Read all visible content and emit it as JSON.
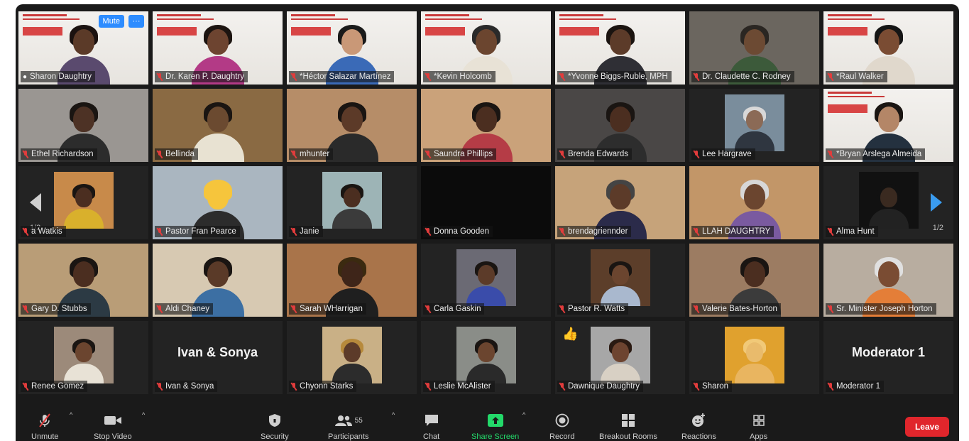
{
  "tiles": [
    {
      "name": "Sharon Daughtry",
      "speaker": true,
      "mic_off": false,
      "bg": "slide",
      "skin": "#5b3a28",
      "hair": "#1b1210",
      "shirt": "#5a4a6e"
    },
    {
      "name": "Dr. Karen P. Daughtry",
      "mic_off": true,
      "bg": "slide",
      "skin": "#6d4430",
      "hair": "#1c1410",
      "shirt": "#b33a86"
    },
    {
      "name": "*Héctor Salazar Martínez",
      "mic_off": true,
      "bg": "slide",
      "skin": "#c99877",
      "hair": "#1a1a1a",
      "shirt": "#3a6ab7"
    },
    {
      "name": "*Kevin Holcomb",
      "mic_off": true,
      "bg": "slide",
      "skin": "#6b452f",
      "hair": "#2a2a2a",
      "shirt": "#e8e2d6"
    },
    {
      "name": "*Yvonne Biggs-Ruble, MPH",
      "mic_off": true,
      "bg": "slide",
      "skin": "#5c3b29",
      "hair": "#1b1410",
      "shirt": "#2f2f35"
    },
    {
      "name": "Dr. Claudette C. Rodney",
      "mic_off": true,
      "bg": "#6b665f",
      "skin": "#6c4a33",
      "hair": "#2a2622",
      "shirt": "#3c5a3a"
    },
    {
      "name": "*Raul Walker",
      "mic_off": true,
      "bg": "slide",
      "skin": "#7a4c33",
      "hair": "#151515",
      "shirt": "#e0d8cc"
    },
    {
      "name": "Ethel Richardson",
      "mic_off": true,
      "bg": "#9a9692",
      "skin": "#4d3225",
      "hair": "#1a1512",
      "shirt": "#2c2c2c"
    },
    {
      "name": "Bellinda",
      "mic_off": true,
      "bg": "#8a6a43",
      "skin": "#6b4a30",
      "hair": "#1a1512",
      "shirt": "#e8e2d2"
    },
    {
      "name": "mhunter",
      "mic_off": true,
      "bg": "#b68d68",
      "skin": "#5c3a28",
      "hair": "#1a1512",
      "shirt": "#2a2a2a"
    },
    {
      "name": "Saundra Phillips",
      "mic_off": true,
      "bg": "#caa27a",
      "skin": "#4b2e20",
      "hair": "#1a1512",
      "shirt": "#b53c46"
    },
    {
      "name": "Brenda Edwards",
      "mic_off": true,
      "bg": "#4a4746",
      "skin": "#4b2e20",
      "hair": "#1a1512",
      "shirt": "#2d2d2d"
    },
    {
      "name": "Lee Hargrave",
      "mic_off": true,
      "bg": "#232323",
      "thumb": "#7a8d9c",
      "skin": "#8b6a56",
      "hair": "#d8d8d8",
      "shirt": "#2f3640"
    },
    {
      "name": "*Bryan Arslega Almeida",
      "mic_off": true,
      "bg": "slide",
      "skin": "#b48667",
      "hair": "#1a1512",
      "shirt": "#24313f"
    },
    {
      "name": "a Watkis",
      "mic_off": true,
      "bg": "#232323",
      "thumb": "#c88a4a",
      "skin": "#4b2e20",
      "hair": "#1a1512",
      "shirt": "#d9b02c",
      "nav": "left",
      "page": "1/2"
    },
    {
      "name": "Pastor Fran Pearce",
      "mic_off": true,
      "bg": "#aab6c0",
      "skin": "#f6c53c",
      "hair": "#f6c53c",
      "shirt": "#2c2c2c"
    },
    {
      "name": "Janie",
      "mic_off": true,
      "bg": "#232323",
      "thumb": "#9db4b6",
      "skin": "#4b2e20",
      "hair": "#1a1512",
      "shirt": "#3b3b3b"
    },
    {
      "name": "Donna Gooden",
      "mic_off": true,
      "bg": "#0b0b0b",
      "empty": true
    },
    {
      "name": "brendagriennder",
      "mic_off": true,
      "bg": "#c6a37a",
      "skin": "#5c3b29",
      "hair": "#444444",
      "shirt": "#2b2b4a"
    },
    {
      "name": "LLAH DAUGHTRY",
      "mic_off": true,
      "bg": "#c29668",
      "skin": "#6b452f",
      "hair": "#d7d7d7",
      "shirt": "#7a5aa0"
    },
    {
      "name": "Alma Hunt",
      "mic_off": true,
      "bg": "#232323",
      "thumb": "#111111",
      "skin": "#3a2a20",
      "hair": "#111111",
      "shirt": "#222222",
      "nav": "right",
      "page": "1/2"
    },
    {
      "name": "Gary D. Stubbs",
      "mic_off": true,
      "bg": "#b99d77",
      "skin": "#4b2e20",
      "hair": "#1a1512",
      "shirt": "#2c3a44"
    },
    {
      "name": "Aldi Chaney",
      "mic_off": true,
      "bg": "#d7c9b2",
      "skin": "#5a3a28",
      "hair": "#1a1512",
      "shirt": "#3c6fa3"
    },
    {
      "name": "Sarah WHarrigan",
      "mic_off": true,
      "bg": "#a9744a",
      "skin": "#3e2519",
      "hair": "#3b2a10",
      "shirt": "#1f1f1f"
    },
    {
      "name": "Carla Gaskin",
      "mic_off": true,
      "bg": "#232323",
      "thumb": "#6b6a74",
      "skin": "#5c3b29",
      "hair": "#1a1512",
      "shirt": "#3a4caa"
    },
    {
      "name": "Pastor R. Watts",
      "mic_off": true,
      "bg": "#232323",
      "thumb": "#5c3e2a",
      "skin": "#6b452f",
      "hair": "#1a1512",
      "shirt": "#a9b8ce"
    },
    {
      "name": "Valerie Bates-Horton",
      "mic_off": true,
      "bg": "#9c7c62",
      "skin": "#4b2e20",
      "hair": "#1a1512",
      "shirt": "#3b3b3b"
    },
    {
      "name": "Sr. Minister Joseph Horton",
      "mic_off": true,
      "bg": "#b8ada0",
      "skin": "#7a4c33",
      "hair": "#e0e0e0",
      "shirt": "#e47e38"
    },
    {
      "name": "Renee Gomez",
      "mic_off": true,
      "bg": "#232323",
      "thumb": "#9c8a7a",
      "skin": "#6b452f",
      "hair": "#1a1512",
      "shirt": "#e8e2d6"
    },
    {
      "name": "Ivan & Sonya",
      "mic_off": true,
      "bg": "#232323",
      "title": "Ivan & Sonya"
    },
    {
      "name": "Chyonn Starks",
      "mic_off": true,
      "bg": "#232323",
      "thumb": "#c9b086",
      "skin": "#5c3b29",
      "hair": "#b78a3c",
      "shirt": "#2c2c2c"
    },
    {
      "name": "Leslie McAlister",
      "mic_off": true,
      "bg": "#232323",
      "thumb": "#8a8d88",
      "skin": "#6b452f",
      "hair": "#1a1512",
      "shirt": "#2a2a2a"
    },
    {
      "name": "Dawnique Daughtry",
      "mic_off": true,
      "bg": "#232323",
      "thumb": "#a7a7a7",
      "skin": "#6d4430",
      "hair": "#2a1a12",
      "shirt": "#d8d0c4",
      "reaction": true
    },
    {
      "name": "Sharon",
      "mic_off": true,
      "bg": "#232323",
      "thumb": "#e0a12e",
      "skin": "#e9bb6c",
      "hair": "#f1c978",
      "shirt": "#e9b560"
    },
    {
      "name": "Moderator 1",
      "mic_off": true,
      "bg": "#232323",
      "title": "Moderator 1"
    }
  ],
  "speaker_controls": {
    "mute": "Mute",
    "more": "···"
  },
  "toolbar": {
    "unmute": "Unmute",
    "stop_video": "Stop Video",
    "security": "Security",
    "participants": "Participants",
    "participants_count": "55",
    "chat": "Chat",
    "share_screen": "Share Screen",
    "record": "Record",
    "breakout_rooms": "Breakout Rooms",
    "reactions": "Reactions",
    "apps": "Apps",
    "leave": "Leave"
  },
  "colors": {
    "accent": "#2d8cff",
    "share": "#23d96a",
    "leave": "#e0262c",
    "active_border": "#c8e04a"
  }
}
